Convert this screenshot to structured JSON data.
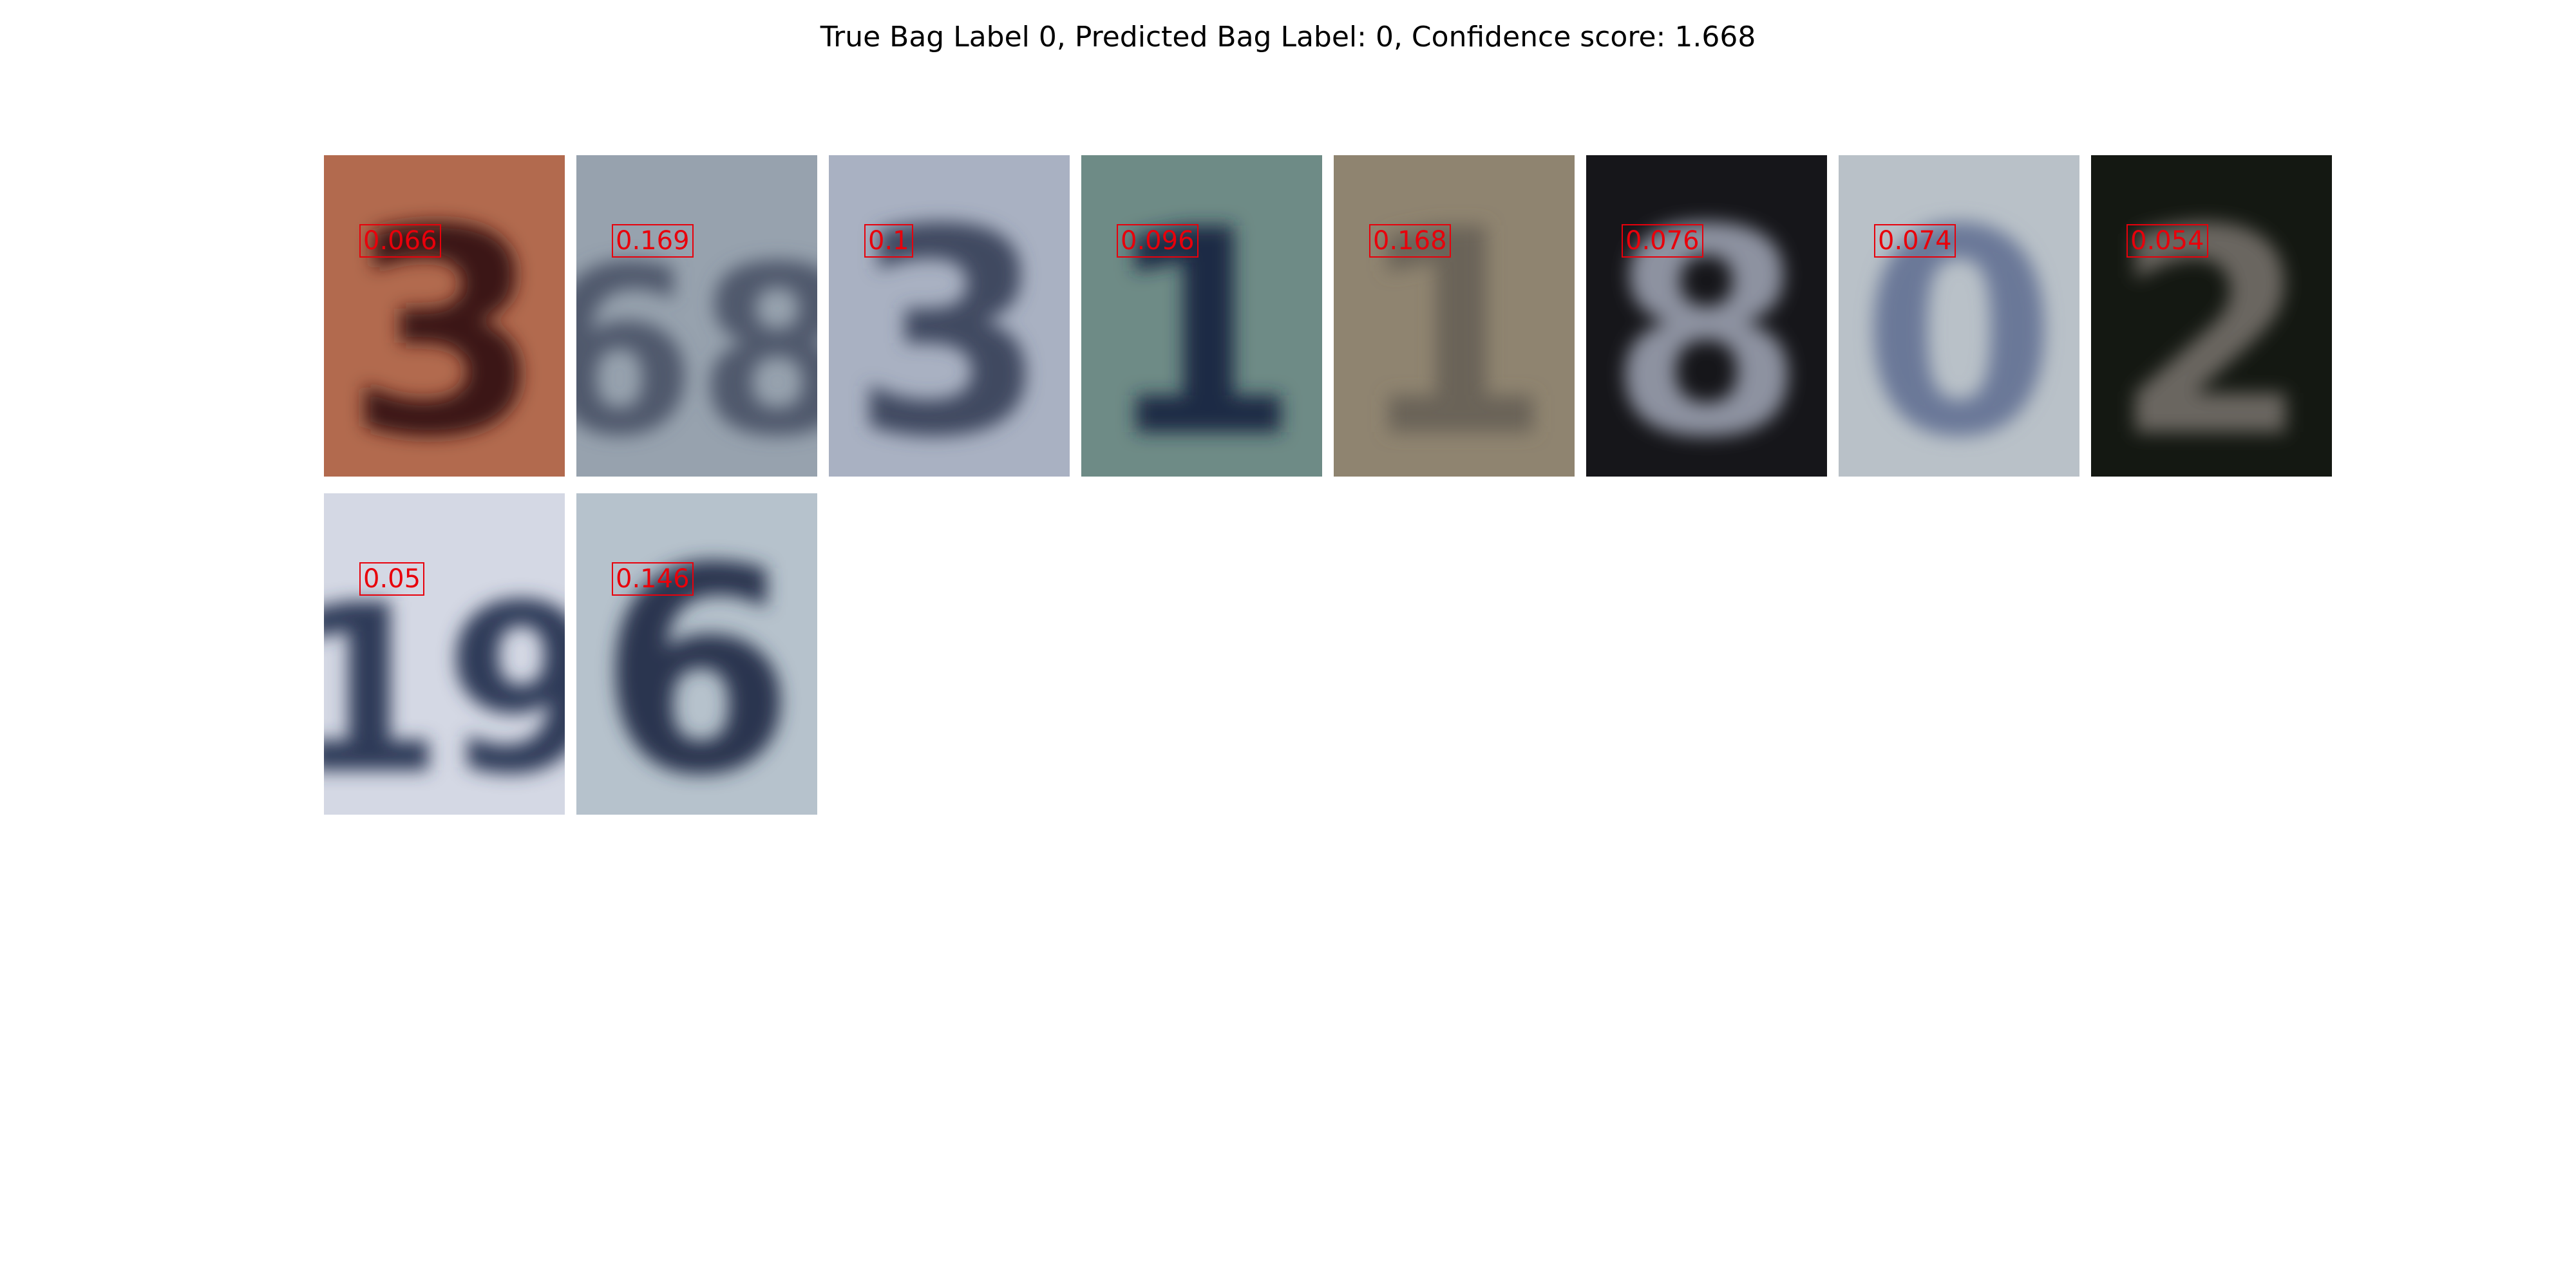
{
  "title": "True Bag Label 0, Predicted Bag Label: 0, Confidence score: 1.668",
  "tiles": [
    {
      "score": "0.066",
      "digit_icon": "digit-3-icon",
      "bg": "#b26a4e",
      "ink": "#3a1616",
      "glyph": "3"
    },
    {
      "score": "0.169",
      "digit_icon": "digit-68-icon",
      "bg": "#97a2ae",
      "ink": "#4f586c",
      "glyph": "68"
    },
    {
      "score": "0.1",
      "digit_icon": "digit-3-icon",
      "bg": "#a9b1c2",
      "ink": "#3f4860",
      "glyph": "3"
    },
    {
      "score": "0.096",
      "digit_icon": "digit-1-icon",
      "bg": "#6e8b86",
      "ink": "#1c2a44",
      "glyph": "1"
    },
    {
      "score": "0.168",
      "digit_icon": "digit-1-icon",
      "bg": "#8f8470",
      "ink": "#6b6458",
      "glyph": "1"
    },
    {
      "score": "0.076",
      "digit_icon": "digit-8-icon",
      "bg": "#16161a",
      "ink": "#8d92a0",
      "glyph": "8"
    },
    {
      "score": "0.074",
      "digit_icon": "digit-0-icon",
      "bg": "#b9c1c8",
      "ink": "#6a7898",
      "glyph": "0"
    },
    {
      "score": "0.054",
      "digit_icon": "digit-2-icon",
      "bg": "#141812",
      "ink": "#6b6660",
      "glyph": "2"
    },
    {
      "score": "0.05",
      "digit_icon": "digit-19-icon",
      "bg": "#d4d8e4",
      "ink": "#2f3a58",
      "glyph": "19"
    },
    {
      "score": "0.146",
      "digit_icon": "digit-6-icon",
      "bg": "#b6c2cc",
      "ink": "#2a3650",
      "glyph": "6"
    }
  ]
}
